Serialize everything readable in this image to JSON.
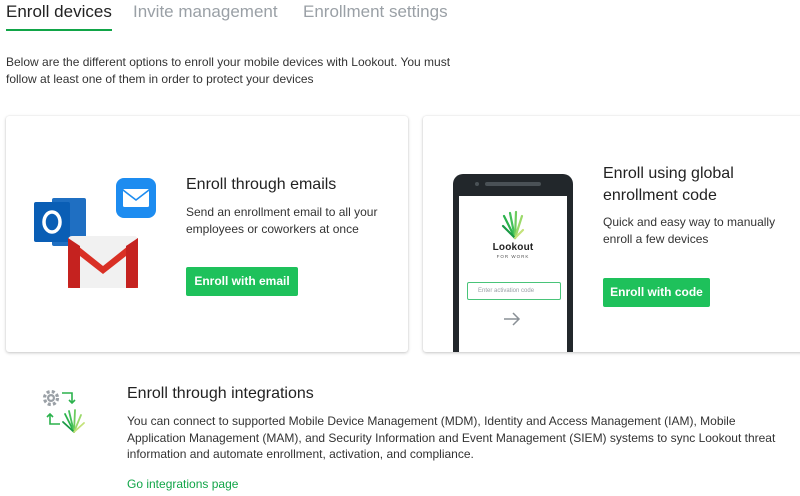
{
  "tabs": [
    {
      "label": "Enroll devices",
      "active": true
    },
    {
      "label": "Invite management",
      "active": false
    },
    {
      "label": "Enrollment settings",
      "active": false
    }
  ],
  "intro": "Below are the different options to enroll your mobile devices with Lookout. You must follow at least one of them in order to protect your devices",
  "cards": {
    "email": {
      "title": "Enroll through emails",
      "description": "Send an enrollment email to all your employees or coworkers at once",
      "button": "Enroll with email",
      "icons": [
        "outlook-icon",
        "apple-mail-icon",
        "gmail-icon"
      ]
    },
    "code": {
      "title": "Enroll using global enrollment code",
      "description": "Quick and easy way to manually enroll a few devices",
      "button": "Enroll with code",
      "phone": {
        "brand": "Lookout",
        "brand_sub": "FOR WORK",
        "input_placeholder": "Enter activation code"
      }
    }
  },
  "integrations": {
    "title": "Enroll through integrations",
    "description": "You can connect to supported Mobile Device Management (MDM), Identity and Access Management (IAM), Mobile Application Management (MAM), and Security Information and Event Management (SIEM) systems to sync Lookout threat information and automate enrollment, activation, and compliance.",
    "link": "Go integrations page"
  },
  "colors": {
    "accent": "#1ec15b",
    "link": "#11a548",
    "tab_inactive": "#9aa0a6"
  }
}
